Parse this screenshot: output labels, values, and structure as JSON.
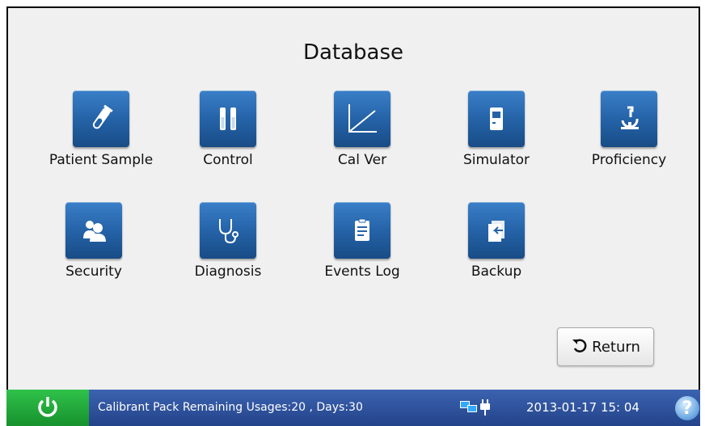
{
  "screen": {
    "title": "Database"
  },
  "tiles": [
    {
      "label": "Patient Sample",
      "icon": "test-tube-icon"
    },
    {
      "label": "Control",
      "icon": "vials-icon"
    },
    {
      "label": "Cal Ver",
      "icon": "line-graph-icon"
    },
    {
      "label": "Simulator",
      "icon": "simulator-icon"
    },
    {
      "label": "Proficiency",
      "icon": "microscope-icon"
    },
    {
      "label": "Security",
      "icon": "users-icon"
    },
    {
      "label": "Diagnosis",
      "icon": "stethoscope-icon"
    },
    {
      "label": "Events Log",
      "icon": "clipboard-icon"
    },
    {
      "label": "Backup",
      "icon": "backup-icon"
    }
  ],
  "return_button": {
    "label": "Return",
    "icon": "return-arrow-icon"
  },
  "status_bar": {
    "message": "Calibrant Pack Remaining Usages:20 , Days:30",
    "datetime": "2013-01-17  15: 04",
    "help": "?"
  },
  "colors": {
    "tile_blue": "#2563a8",
    "status_blue": "#2f52a0",
    "power_green": "#22a83a",
    "background": "#f0f0f0"
  }
}
